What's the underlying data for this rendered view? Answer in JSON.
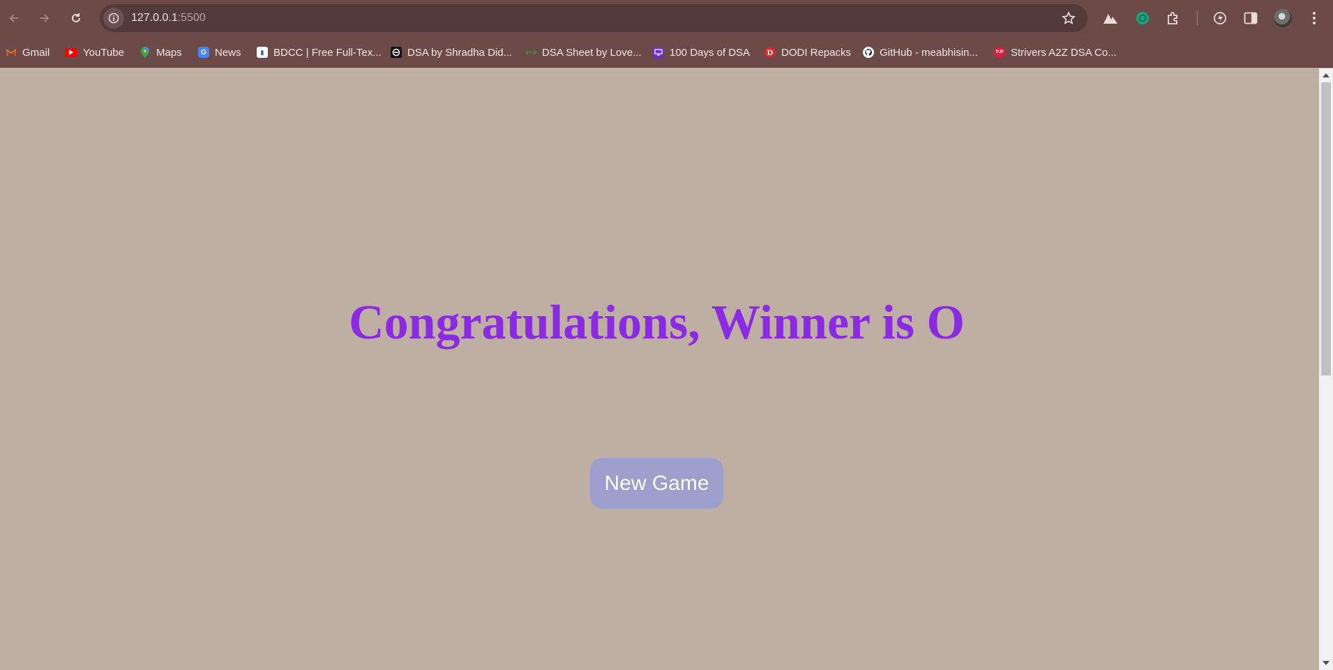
{
  "browser": {
    "url_host": "127.0.0.1",
    "url_port": ":5500",
    "colors": {
      "chrome": "#6b4a47",
      "omnibox": "#523b39"
    }
  },
  "bookmarks": [
    {
      "label": "Gmail",
      "icon": "gmail-icon"
    },
    {
      "label": "YouTube",
      "icon": "youtube-icon"
    },
    {
      "label": "Maps",
      "icon": "maps-icon"
    },
    {
      "label": "News",
      "icon": "news-icon"
    },
    {
      "label": "BDCC | Free Full-Tex...",
      "icon": "bdcc-icon"
    },
    {
      "label": "DSA by Shradha Did...",
      "icon": "dsa-shradha-icon"
    },
    {
      "label": "DSA Sheet by Love...",
      "icon": "dsa-love-icon"
    },
    {
      "label": "100 Days of DSA",
      "icon": "days-dsa-icon"
    },
    {
      "label": "DODI Repacks",
      "icon": "dodi-icon"
    },
    {
      "label": "GitHub - meabhisin...",
      "icon": "github-icon"
    },
    {
      "label": "Strivers A2Z DSA Co...",
      "icon": "tuf-icon"
    }
  ],
  "page": {
    "message": "Congratulations, Winner is O",
    "new_game_label": "New Game",
    "colors": {
      "background": "#bfaea4",
      "message": "#8a2be2",
      "button": "#9c9ecc"
    }
  }
}
